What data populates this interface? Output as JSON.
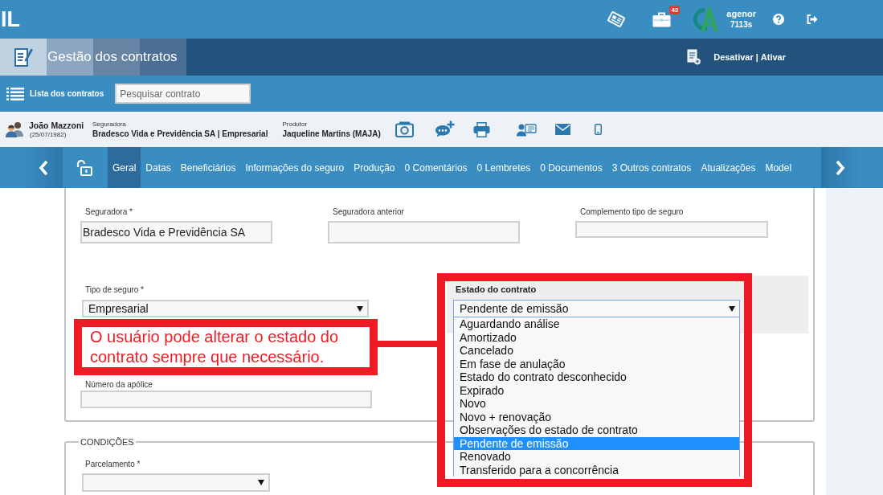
{
  "header": {
    "brand": "IL",
    "notification_count": "43",
    "user": {
      "name": "agenor",
      "code": "7113s"
    }
  },
  "module_bar": {
    "title": "Gestão dos contratos",
    "actions": [
      {
        "label": "Desativar"
      },
      {
        "label": "Ativar"
      }
    ],
    "separator": "|"
  },
  "toolbar": {
    "list_link": "Lista dos contratos",
    "search": {
      "placeholder": "Pesquisar contrato"
    }
  },
  "contract_summary": {
    "client": {
      "name": "João Mazzoni",
      "birth_date": "(25/07/1982)"
    },
    "insurer": {
      "label": "Seguradora",
      "value": "Bradesco Vida e Previdência SA | Empresarial"
    },
    "producer": {
      "label": "Produtor",
      "value": "Jaqueline Martins (MAJA)"
    }
  },
  "tabs": [
    {
      "label": "Geral",
      "selected": true
    },
    {
      "label": "Datas",
      "selected": false
    },
    {
      "label": "Beneficiários",
      "selected": false
    },
    {
      "label": "Informações do seguro",
      "selected": false
    },
    {
      "label": "Produção",
      "selected": false
    },
    {
      "label": "0 Comentários",
      "selected": false
    },
    {
      "label": "0 Lembretes",
      "selected": false
    },
    {
      "label": "0 Documentos",
      "selected": false
    },
    {
      "label": "3 Outros contratos",
      "selected": false
    },
    {
      "label": "Atualizações",
      "selected": false
    },
    {
      "label": "Model",
      "selected": false
    }
  ],
  "form": {
    "insurer": {
      "label": "Seguradora *",
      "value": "Bradesco Vida e Previdência SA"
    },
    "previous_insurer": {
      "label": "Seguradora anterior"
    },
    "insurance_type_complement": {
      "label": "Complemento tipo de seguro"
    },
    "insurance_type": {
      "label": "Tipo de seguro *",
      "value": "Empresarial"
    },
    "contract_state": {
      "label": "Estado do contrato",
      "value": "Pendente de emissão",
      "expanded": true,
      "options": [
        {
          "label": "Aguardando análise",
          "selected": false
        },
        {
          "label": "Amortizado",
          "selected": false
        },
        {
          "label": "Cancelado",
          "selected": false
        },
        {
          "label": "Em fase de anulação",
          "selected": false
        },
        {
          "label": "Estado do contrato desconhecido",
          "selected": false
        },
        {
          "label": "Expirado",
          "selected": false
        },
        {
          "label": "Novo",
          "selected": false
        },
        {
          "label": "Novo + renovação",
          "selected": false
        },
        {
          "label": "Observações do estado de contrato",
          "selected": false
        },
        {
          "label": "Pendente de emissão",
          "selected": true
        },
        {
          "label": "Renovado",
          "selected": false
        },
        {
          "label": "Transferido para a concorrência",
          "selected": false
        }
      ]
    },
    "policy_number": {
      "label": "Número da apólice"
    }
  },
  "conditions": {
    "legend": "CONDIÇÕES",
    "installments": {
      "label": "Parcelamento *"
    }
  },
  "annotation": {
    "text": "O usuário pode alterar o estado do contrato sempre que necessário."
  }
}
